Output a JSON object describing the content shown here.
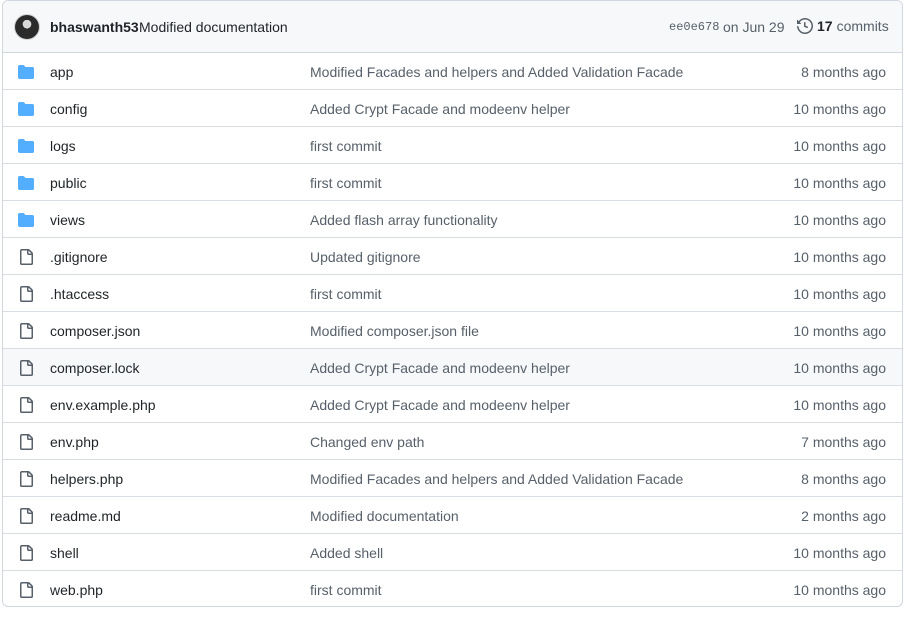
{
  "latest_commit": {
    "author": "bhaswanth53",
    "message": "Modified documentation",
    "sha": "ee0e678",
    "date": "on Jun 29",
    "commit_count": "17",
    "commits_label": "commits"
  },
  "colors": {
    "folder": "#54aeff",
    "file": "#57606a"
  },
  "files": [
    {
      "type": "folder",
      "icon": "folder-icon",
      "name": "app",
      "commit": "Modified Facades and helpers and Added Validation Facade",
      "age": "8 months ago"
    },
    {
      "type": "folder",
      "icon": "folder-icon",
      "name": "config",
      "commit": "Added Crypt Facade and modeenv helper",
      "age": "10 months ago"
    },
    {
      "type": "folder",
      "icon": "folder-icon",
      "name": "logs",
      "commit": "first commit",
      "age": "10 months ago"
    },
    {
      "type": "folder",
      "icon": "folder-icon",
      "name": "public",
      "commit": "first commit",
      "age": "10 months ago"
    },
    {
      "type": "folder",
      "icon": "folder-icon",
      "name": "views",
      "commit": "Added flash array functionality",
      "age": "10 months ago"
    },
    {
      "type": "file",
      "icon": "file-icon",
      "name": ".gitignore",
      "commit": "Updated gitignore",
      "age": "10 months ago"
    },
    {
      "type": "file",
      "icon": "file-icon",
      "name": ".htaccess",
      "commit": "first commit",
      "age": "10 months ago"
    },
    {
      "type": "file",
      "icon": "file-icon",
      "name": "composer.json",
      "commit": "Modified composer.json file",
      "age": "10 months ago"
    },
    {
      "type": "file",
      "icon": "file-icon",
      "name": "composer.lock",
      "commit": "Added Crypt Facade and modeenv helper",
      "age": "10 months ago",
      "hover": true
    },
    {
      "type": "file",
      "icon": "file-icon",
      "name": "env.example.php",
      "commit": "Added Crypt Facade and modeenv helper",
      "age": "10 months ago"
    },
    {
      "type": "file",
      "icon": "file-icon",
      "name": "env.php",
      "commit": "Changed env path",
      "age": "7 months ago"
    },
    {
      "type": "file",
      "icon": "file-icon",
      "name": "helpers.php",
      "commit": "Modified Facades and helpers and Added Validation Facade",
      "age": "8 months ago"
    },
    {
      "type": "file",
      "icon": "file-icon",
      "name": "readme.md",
      "commit": "Modified documentation",
      "age": "2 months ago"
    },
    {
      "type": "file",
      "icon": "file-icon",
      "name": "shell",
      "commit": "Added shell",
      "age": "10 months ago"
    },
    {
      "type": "file",
      "icon": "file-icon",
      "name": "web.php",
      "commit": "first commit",
      "age": "10 months ago"
    }
  ]
}
